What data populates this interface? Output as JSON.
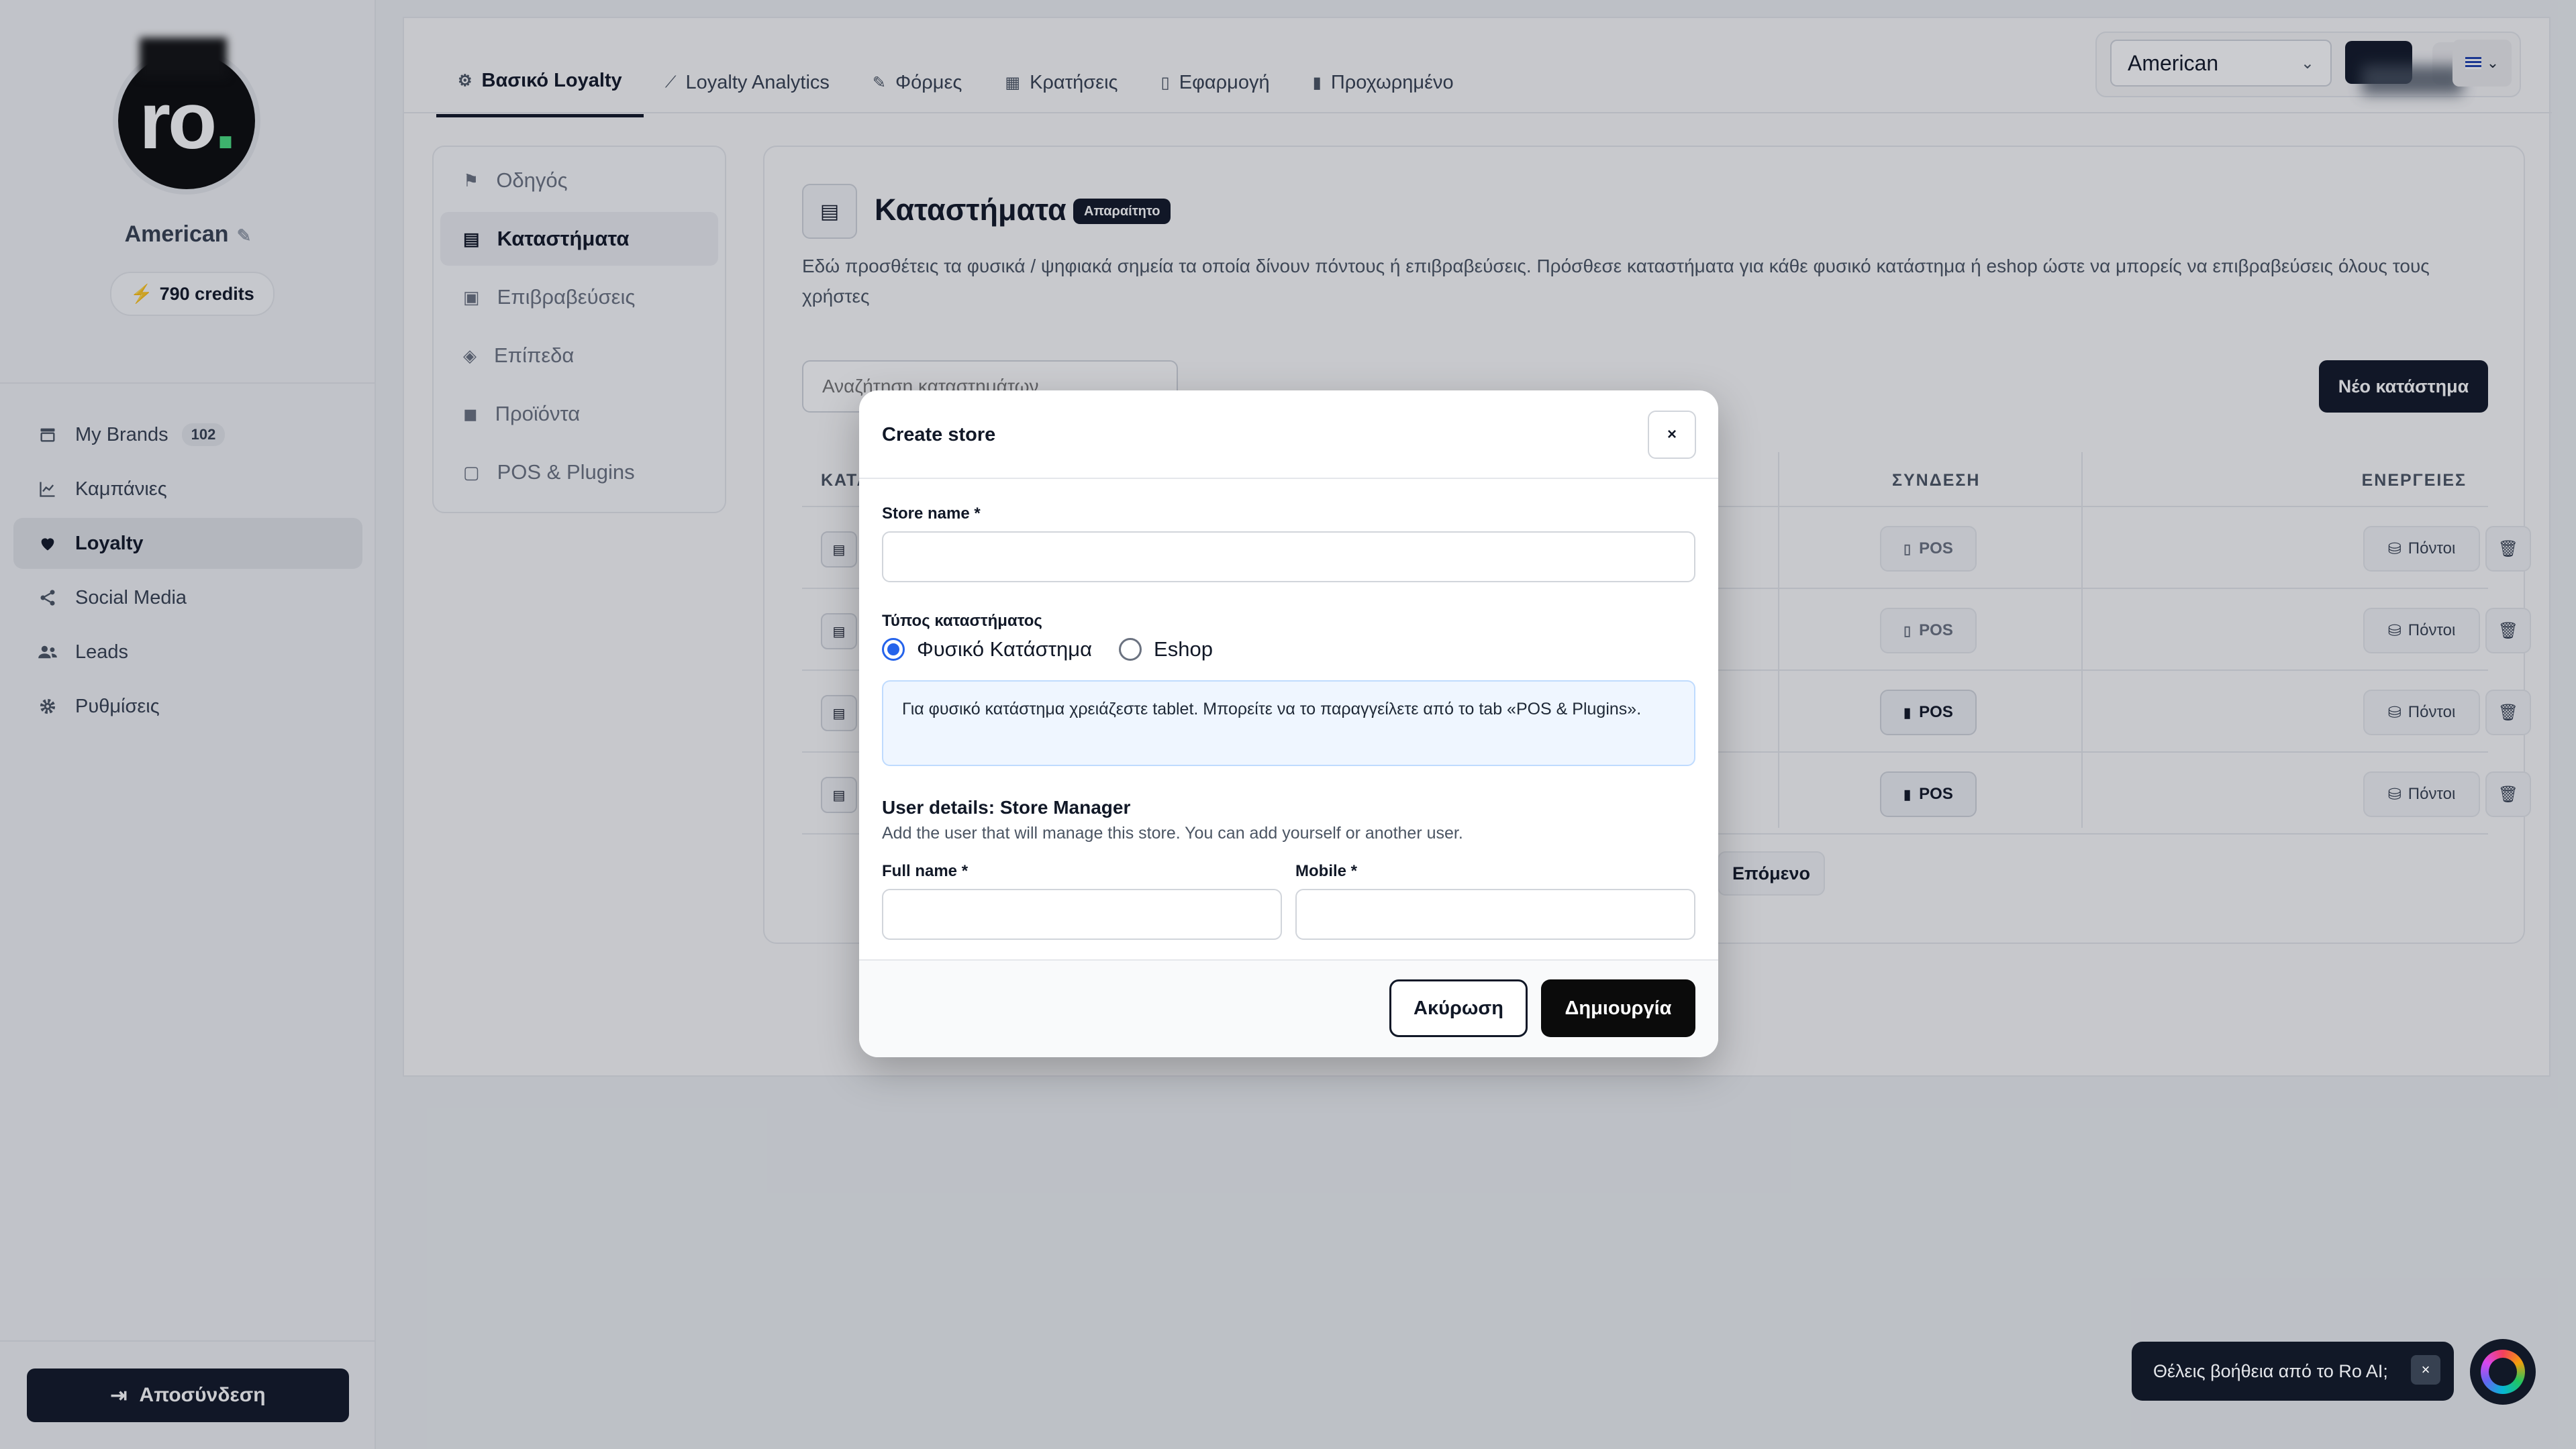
{
  "sidebar": {
    "brand_name": "American",
    "credits": "790 credits",
    "nav": [
      {
        "label": "My Brands",
        "count": "102"
      },
      {
        "label": "Καμπάνιες"
      },
      {
        "label": "Loyalty"
      },
      {
        "label": "Social Media"
      },
      {
        "label": "Leads"
      },
      {
        "label": "Ρυθμίσεις"
      }
    ],
    "logout_label": "Αποσύνδεση"
  },
  "tabs": [
    {
      "label": "Βασικό Loyalty",
      "icon": "gear-icon",
      "active": true
    },
    {
      "label": "Loyalty Analytics",
      "icon": "chart-icon"
    },
    {
      "label": "Φόρμες",
      "icon": "edit-icon"
    },
    {
      "label": "Κρατήσεις",
      "icon": "calendar-icon"
    },
    {
      "label": "Εφαρμογή",
      "icon": "phone-icon"
    },
    {
      "label": "Προχωρημένο",
      "icon": "bookmark-icon"
    }
  ],
  "topbar": {
    "brand_select": "American"
  },
  "subnav": [
    {
      "label": "Οδηγός",
      "icon": "signpost-icon"
    },
    {
      "label": "Καταστήματα",
      "icon": "store-icon",
      "active": true
    },
    {
      "label": "Επιβραβεύσεις",
      "icon": "gift-icon"
    },
    {
      "label": "Επίπεδα",
      "icon": "layers-icon"
    },
    {
      "label": "Προϊόντα",
      "icon": "bag-icon"
    },
    {
      "label": "POS & Plugins",
      "icon": "tablet-icon"
    }
  ],
  "stores": {
    "title": "Καταστήματα",
    "required_badge": "Απαραίτητο",
    "description": "Εδώ προσθέτεις τα φυσικά / ψηφιακά σημεία τα οποία δίνουν πόντους ή επιβραβεύσεις. Πρόσθεσε καταστήματα για κάθε φυσικό κατάστημα ή eshop ώστε να μπορείς να επιβραβεύσεις όλους τους χρήστες",
    "search_placeholder": "Αναζήτηση καταστημάτων...",
    "new_button": "Νέο κατάστημα",
    "columns": {
      "store": "ΚΑΤΑ",
      "connection": "ΣΥΝΔΕΣΗ",
      "actions": "ΕΝΕΡΓΕΙΕΣ"
    },
    "rows": [
      {
        "connection": "POS",
        "connected": false,
        "points_label": "Πόντοι"
      },
      {
        "connection": "POS",
        "connected": false,
        "points_label": "Πόντοι"
      },
      {
        "connection": "POS",
        "connected": true,
        "points_label": "Πόντοι"
      },
      {
        "connection": "POS",
        "connected": true,
        "points_label": "Πόντοι"
      }
    ],
    "next_label": "Επόμενο"
  },
  "modal": {
    "title": "Create store",
    "close": "×",
    "store_name_label": "Store name *",
    "store_type_label": "Τύπος καταστήματος",
    "type_options": [
      "Φυσικό Κατάστημα",
      "Eshop"
    ],
    "selected_type": "Φυσικό Κατάστημα",
    "info": "Για φυσικό κατάστημα χρειάζεστε tablet. Μπορείτε να το παραγγείλετε από το tab «POS & Plugins».",
    "user_section_title": "User details: Store Manager",
    "user_section_sub": "Add the user that will manage this store. You can add yourself or another user.",
    "full_name_label": "Full name *",
    "mobile_label": "Mobile *",
    "cancel": "Ακύρωση",
    "create": "Δημιουργία"
  },
  "ai_helper": {
    "text": "Θέλεις βοήθεια από το Ro AI;",
    "close": "×"
  }
}
